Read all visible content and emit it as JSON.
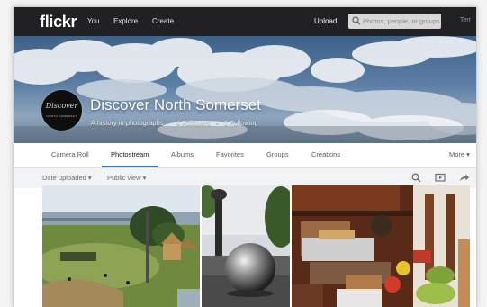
{
  "nav": {
    "logo": "flickr",
    "links": [
      "You",
      "Explore",
      "Create"
    ],
    "upload": "Upload",
    "search_placeholder": "Photos, people, or groups",
    "account": "Terr"
  },
  "cover": {
    "avatar_signature": "Discover",
    "avatar_sub": "NORTH SOMERSET",
    "title": "Discover North Somerset",
    "subtitle": "A history in photographs",
    "followers": "4 Followers",
    "following": "0 Following",
    "separator": "•"
  },
  "tabs": [
    "Camera Roll",
    "Photostream",
    "Albums",
    "Favorites",
    "Groups",
    "Creations"
  ],
  "active_tab": "Photostream",
  "more": "More ▾",
  "filters": {
    "date": "Date uploaded ▾",
    "view": "Public view ▾"
  },
  "icons": [
    "search-icon",
    "slideshow-icon",
    "share-icon"
  ],
  "colors": {
    "nav_bg": "#212124",
    "accent": "#3c7bb4",
    "filter_bg": "#f2f3f5"
  }
}
